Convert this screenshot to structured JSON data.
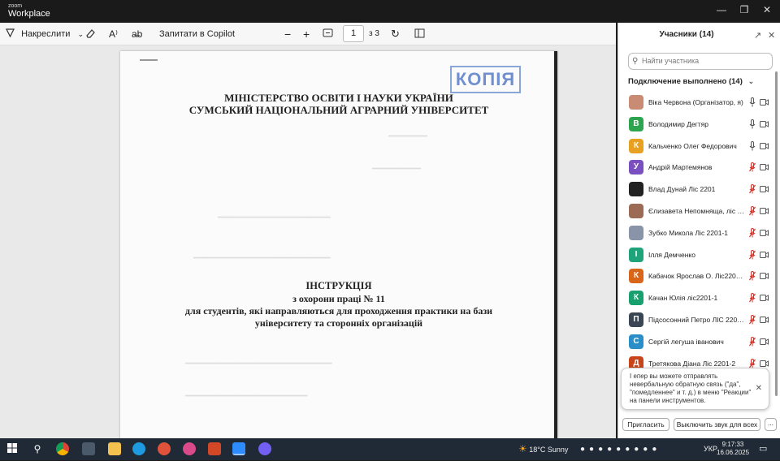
{
  "titlebar": {
    "brand_small": "zoom",
    "brand_big": "Workplace"
  },
  "toolbar": {
    "draw_label": "Накреслити",
    "ask_copilot_label": "Запитати в Copilot",
    "page_value": "1",
    "page_of": "з 3"
  },
  "document": {
    "stamp": "КОПІЯ",
    "ministry": "МІНІСТЕРСТВО ОСВІТИ І НАУКИ УКРАЇНИ",
    "university": "СУМСЬКИЙ НАЦІОНАЛЬНИЙ АГРАРНИЙ УНІВЕРСИТЕТ",
    "doc_title": "ІНСТРУКЦІЯ",
    "line2": "з охорони праці  № 11",
    "line3": "для студентів, які направляються для проходження практики на бази",
    "line4": "університету та сторонніх організацій"
  },
  "panel": {
    "title": "Учасники (14)",
    "search_placeholder": "Найти участника",
    "connected_label": "Подключение выполнено (14)",
    "participants": [
      {
        "name": "Віка Червона (Організатор, я)",
        "initial": "",
        "color": "#c98b73",
        "mic": "on",
        "cam": "off"
      },
      {
        "name": "Володимир Дегтяр",
        "initial": "В",
        "color": "#2da44e",
        "mic": "on",
        "cam": "off"
      },
      {
        "name": "Кальченко Олег Федорович",
        "initial": "К",
        "color": "#e8a020",
        "mic": "on",
        "cam": "off"
      },
      {
        "name": "Андрій Мартемянов",
        "initial": "У",
        "color": "#7a4fc0",
        "mic": "muted",
        "cam": "off"
      },
      {
        "name": "Влад Дунай Ліс 2201",
        "initial": "",
        "color": "#222222",
        "mic": "muted",
        "cam": "off"
      },
      {
        "name": "Єлизавета Непомняща, ліс 22...",
        "initial": "",
        "color": "#9b6b55",
        "mic": "muted",
        "cam": "off"
      },
      {
        "name": "Зубко Микола  Ліс 2201-1",
        "initial": "",
        "color": "#8a94a8",
        "mic": "muted",
        "cam": "off"
      },
      {
        "name": "Ілля Демченко",
        "initial": "І",
        "color": "#1fa37a",
        "mic": "muted",
        "cam": "off"
      },
      {
        "name": "Кабачок Ярослав О. Ліс2201-1",
        "initial": "К",
        "color": "#d9651a",
        "mic": "muted",
        "cam": "off"
      },
      {
        "name": "Качан Юлія ліс2201-1",
        "initial": "К",
        "color": "#18a06e",
        "mic": "muted",
        "cam": "off"
      },
      {
        "name": "Підсосонний Петро ЛІС 2201-2",
        "initial": "П",
        "color": "#3b4654",
        "mic": "muted",
        "cam": "off"
      },
      {
        "name": "Сергій легуша іванович",
        "initial": "С",
        "color": "#2a8ec8",
        "mic": "muted",
        "cam": "off"
      },
      {
        "name": "Третякова Діана  Ліс 2201-2",
        "initial": "Д",
        "color": "#c8441a",
        "mic": "muted",
        "cam": "off"
      }
    ],
    "toast_text": "І епер вы можете отправлять невербальную обратную связь (\"да\", \"помедленнее\" и т. д.) в меню \"Реакции\" на панели инструментов.",
    "invite_label": "Пригласить",
    "mute_all_label": "Выключить звук для всех",
    "more_label": "..."
  },
  "taskbar": {
    "weather_temp": "18°C",
    "weather_desc": "Sunny",
    "lang": "УКР",
    "time": "9:17:33",
    "date": "16.06.2025"
  },
  "colors": {
    "accent": "#0b5cff",
    "muted_red": "#d93025"
  }
}
